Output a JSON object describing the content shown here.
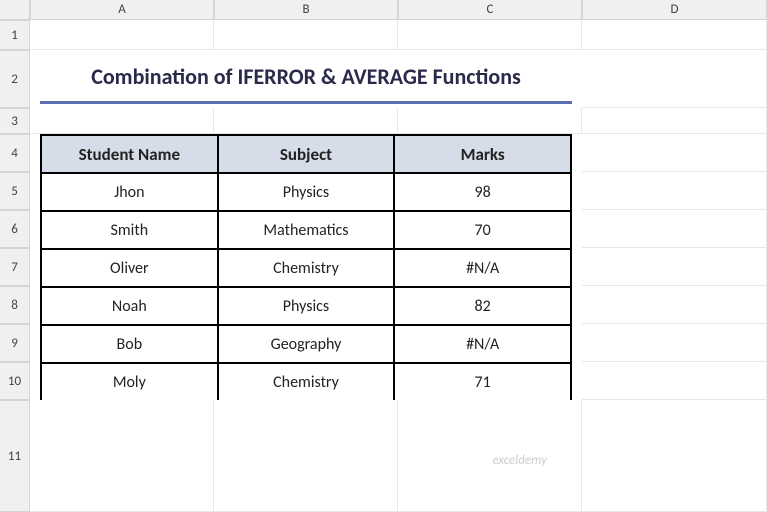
{
  "grid": {
    "columns": [
      "A",
      "B",
      "C",
      "D"
    ],
    "rows": [
      "1",
      "2",
      "3",
      "4",
      "5",
      "6",
      "7",
      "8",
      "9",
      "10",
      "11"
    ]
  },
  "title": "Combination of IFERROR & AVERAGE Functions",
  "table": {
    "headers": [
      "Student Name",
      "Subject",
      "Marks"
    ],
    "rows": [
      {
        "name": "Jhon",
        "subject": "Physics",
        "marks": "98"
      },
      {
        "name": "Smith",
        "subject": "Mathematics",
        "marks": "70"
      },
      {
        "name": "Oliver",
        "subject": "Chemistry",
        "marks": "#N/A"
      },
      {
        "name": "Noah",
        "subject": "Physics",
        "marks": "82"
      },
      {
        "name": "Bob",
        "subject": "Geography",
        "marks": "#N/A"
      },
      {
        "name": "Moly",
        "subject": "Chemistry",
        "marks": "71"
      }
    ]
  },
  "watermark": "exceldemy"
}
